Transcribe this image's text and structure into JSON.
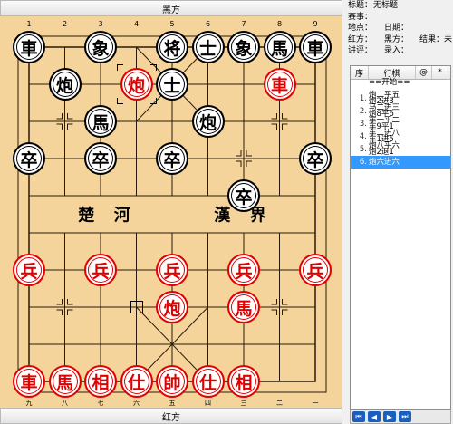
{
  "board": {
    "top_label": "黑方",
    "bottom_label": "红方",
    "top_files": [
      "1",
      "2",
      "3",
      "4",
      "5",
      "6",
      "7",
      "8",
      "9"
    ],
    "bottom_files": [
      "九",
      "八",
      "七",
      "六",
      "五",
      "四",
      "三",
      "二",
      "一"
    ],
    "river_left": [
      "楚",
      "河"
    ],
    "river_right": [
      "漢",
      "界"
    ],
    "colors": {
      "wood": "#f4d49b",
      "line": "#2a1a0a",
      "black": "#000000",
      "red": "#e00000"
    },
    "pieces": [
      {
        "char": "車",
        "side": "black",
        "file": 0,
        "rank": 0
      },
      {
        "char": "象",
        "side": "black",
        "file": 2,
        "rank": 0
      },
      {
        "char": "将",
        "side": "black",
        "file": 4,
        "rank": 0
      },
      {
        "char": "士",
        "side": "black",
        "file": 5,
        "rank": 0
      },
      {
        "char": "象",
        "side": "black",
        "file": 6,
        "rank": 0
      },
      {
        "char": "馬",
        "side": "black",
        "file": 7,
        "rank": 0
      },
      {
        "char": "車",
        "side": "black",
        "file": 8,
        "rank": 0
      },
      {
        "char": "炮",
        "side": "black",
        "file": 1,
        "rank": 1
      },
      {
        "char": "炮",
        "side": "red",
        "file": 3,
        "rank": 1
      },
      {
        "char": "士",
        "side": "black",
        "file": 4,
        "rank": 1
      },
      {
        "char": "車",
        "side": "red",
        "file": 7,
        "rank": 1
      },
      {
        "char": "馬",
        "side": "black",
        "file": 2,
        "rank": 2
      },
      {
        "char": "炮",
        "side": "black",
        "file": 5,
        "rank": 2
      },
      {
        "char": "卒",
        "side": "black",
        "file": 0,
        "rank": 3
      },
      {
        "char": "卒",
        "side": "black",
        "file": 2,
        "rank": 3
      },
      {
        "char": "卒",
        "side": "black",
        "file": 4,
        "rank": 3
      },
      {
        "char": "卒",
        "side": "black",
        "file": 8,
        "rank": 3
      },
      {
        "char": "卒",
        "side": "black",
        "file": 6,
        "rank": 4
      },
      {
        "char": "兵",
        "side": "red",
        "file": 0,
        "rank": 6
      },
      {
        "char": "兵",
        "side": "red",
        "file": 2,
        "rank": 6
      },
      {
        "char": "兵",
        "side": "red",
        "file": 4,
        "rank": 6
      },
      {
        "char": "兵",
        "side": "red",
        "file": 6,
        "rank": 6
      },
      {
        "char": "兵",
        "side": "red",
        "file": 8,
        "rank": 6
      },
      {
        "char": "炮",
        "side": "red",
        "file": 4,
        "rank": 7
      },
      {
        "char": "馬",
        "side": "red",
        "file": 6,
        "rank": 7
      },
      {
        "char": "車",
        "side": "red",
        "file": 0,
        "rank": 9
      },
      {
        "char": "馬",
        "side": "red",
        "file": 1,
        "rank": 9
      },
      {
        "char": "相",
        "side": "red",
        "file": 2,
        "rank": 9
      },
      {
        "char": "仕",
        "side": "red",
        "file": 3,
        "rank": 9
      },
      {
        "char": "帥",
        "side": "red",
        "file": 4,
        "rank": 9
      },
      {
        "char": "仕",
        "side": "red",
        "file": 5,
        "rank": 9
      },
      {
        "char": "相",
        "side": "red",
        "file": 6,
        "rank": 9
      }
    ],
    "selected_from": {
      "file": 3,
      "rank": 7
    },
    "selected_to": {
      "file": 3,
      "rank": 1
    }
  },
  "info": {
    "title_label": "标题：",
    "title_value": "无标题",
    "event_label": "赛事：",
    "place_label": "地点：",
    "date_label": "日期：",
    "red_label": "红方：",
    "black_label": "黑方：",
    "result_label": "结果：",
    "result_value": "未",
    "commentator_label": "讲评：",
    "recorder_label": "录入："
  },
  "movelist": {
    "col_index": "序",
    "col_move": "行棋",
    "col_a": "@",
    "col_b": "*",
    "rows": [
      {
        "n": "",
        "l1": "==开始==",
        "l2": ""
      },
      {
        "n": "1.",
        "l1": "炮二平五",
        "l2": "炮2进3"
      },
      {
        "n": "2.",
        "l1": "马二进三",
        "l2": "炮8平6"
      },
      {
        "n": "3.",
        "l1": "车一平二",
        "l2": "车9平1"
      },
      {
        "n": "4.",
        "l1": "车二进八",
        "l2": "车1进5"
      },
      {
        "n": "5.",
        "l1": "炮八平六",
        "l2": "炮2退1"
      },
      {
        "n": "6.",
        "l1": "炮六进六",
        "l2": ""
      }
    ],
    "selected_index": 6
  },
  "nav": [
    "⏮",
    "◀",
    "▶",
    "⏭"
  ]
}
